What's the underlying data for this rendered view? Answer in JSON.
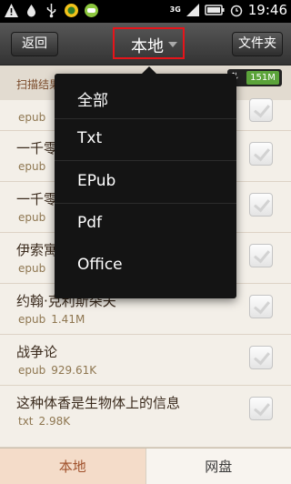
{
  "status_bar": {
    "network": "3G",
    "time": "19:46",
    "icons": [
      "warning-icon",
      "droplet-icon",
      "usb-icon",
      "app-icon",
      "app-icon-2",
      "signal-icon",
      "battery-icon",
      "alarm-icon"
    ]
  },
  "header": {
    "back_label": "返回",
    "title": "本地",
    "folder_label": "文件夹"
  },
  "scan": {
    "label": "扫描结果",
    "storage": "151M"
  },
  "books": [
    {
      "title": "",
      "format": "epub",
      "size": ""
    },
    {
      "title": "一千零一夜·英雄篇",
      "format": "epub",
      "size": ""
    },
    {
      "title": "一千零一夜·市民篇",
      "format": "epub",
      "size": ""
    },
    {
      "title": "伊索寓言",
      "format": "epub",
      "size": ""
    },
    {
      "title": "约翰·克利斯朵夫",
      "format": "epub",
      "size": "1.41M"
    },
    {
      "title": "战争论",
      "format": "epub",
      "size": "929.61K"
    },
    {
      "title": "这种体香是生物体上的信息",
      "format": "txt",
      "size": "2.98K"
    }
  ],
  "dropdown": {
    "options": [
      "全部",
      "Txt",
      "EPub",
      "Pdf",
      "Office"
    ]
  },
  "tabs": {
    "local": "本地",
    "net": "网盘"
  },
  "colors": {
    "highlight_border": "#e6141a",
    "storage_badge": "#5ba33a",
    "active_tab_text": "#a0522d"
  }
}
